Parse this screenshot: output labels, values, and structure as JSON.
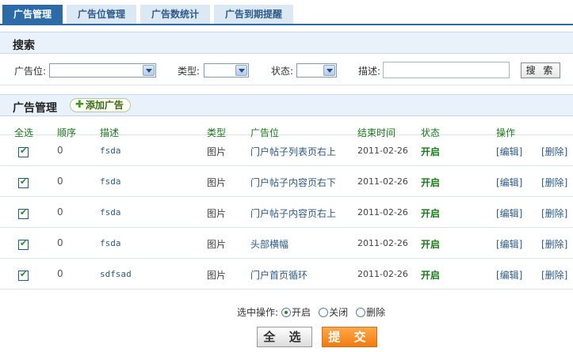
{
  "tabs": [
    {
      "label": "广告管理",
      "active": true
    },
    {
      "label": "广告位管理",
      "active": false
    },
    {
      "label": "广告数统计",
      "active": false
    },
    {
      "label": "广告到期提醒",
      "active": false
    }
  ],
  "search": {
    "title": "搜索",
    "position_label": "广告位:",
    "type_label": "类型:",
    "status_label": "状态:",
    "desc_label": "描述:",
    "position_value": "",
    "type_value": "",
    "status_value": "",
    "desc_value": "",
    "button": "搜 索"
  },
  "ads": {
    "title": "广告管理",
    "add_button": "添加广告",
    "columns": [
      "全选",
      "顺序",
      "描述",
      "类型",
      "广告位",
      "结束时间",
      "状态",
      "操作"
    ],
    "rows": [
      {
        "checked": true,
        "order": "0",
        "desc": "fsda",
        "type": "图片",
        "position": "门户帖子列表页右上",
        "end": "2011-02-26",
        "status": "开启",
        "edit": "[编辑]",
        "delete": "[删除]"
      },
      {
        "checked": true,
        "order": "0",
        "desc": "fsda",
        "type": "图片",
        "position": "门户帖子内容页右下",
        "end": "2011-02-26",
        "status": "开启",
        "edit": "[编辑]",
        "delete": "[删除]"
      },
      {
        "checked": true,
        "order": "0",
        "desc": "fsda",
        "type": "图片",
        "position": "门户帖子内容页右上",
        "end": "2011-02-26",
        "status": "开启",
        "edit": "[编辑]",
        "delete": "[删除]"
      },
      {
        "checked": true,
        "order": "0",
        "desc": "fsda",
        "type": "图片",
        "position": "头部横幅",
        "end": "2011-02-26",
        "status": "开启",
        "edit": "[编辑]",
        "delete": "[删除]"
      },
      {
        "checked": true,
        "order": "0",
        "desc": "sdfsad",
        "type": "图片",
        "position": "门户首页循环",
        "end": "2011-02-26",
        "status": "开启",
        "edit": "[编辑]",
        "delete": "[删除]"
      }
    ]
  },
  "bottom": {
    "ops_label": "选中操作:",
    "options": [
      {
        "label": "开启",
        "selected": true
      },
      {
        "label": "关闭",
        "selected": false
      },
      {
        "label": "删除",
        "selected": false
      }
    ],
    "select_all": "全 选",
    "submit": "提 交"
  },
  "colors": {
    "tab_active": "#2d6aa8",
    "tab_inactive": "#dce8f3",
    "header_text": "#1a7a1a",
    "link": "#2d5b8a",
    "submit": "#f07b10"
  }
}
